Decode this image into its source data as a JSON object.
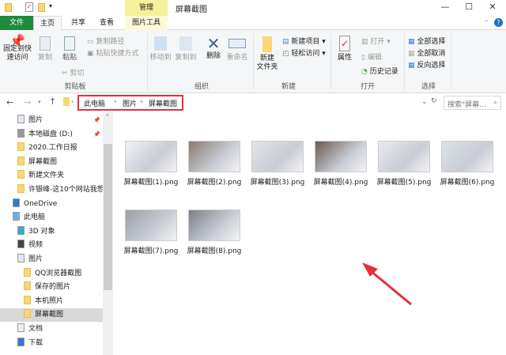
{
  "window": {
    "title": "屏幕截图",
    "contextual_tab": "管理",
    "minimize": "—",
    "maximize": "☐",
    "close": "✕"
  },
  "tabs": [
    {
      "label": "文件"
    },
    {
      "label": "主页"
    },
    {
      "label": "共享"
    },
    {
      "label": "查看"
    },
    {
      "label": "图片工具"
    }
  ],
  "ribbon": {
    "clipboard": {
      "pin": "固定到快\n速访问",
      "copy": "复制",
      "paste": "粘贴",
      "copy_path": "复制路径",
      "paste_shortcut": "粘贴快捷方式",
      "cut": "剪切",
      "label": "剪贴板"
    },
    "organize": {
      "move_to": "移动到",
      "copy_to": "复制到",
      "delete": "删除",
      "rename": "重命名",
      "label": "组织"
    },
    "new": {
      "new_folder": "新建\n文件夹",
      "new_item": "新建项目 ▾",
      "easy_access": "轻松访问 ▾",
      "label": "新建"
    },
    "open": {
      "properties": "属性",
      "open": "打开 ▾",
      "edit": "编辑",
      "history": "历史记录",
      "label": "打开"
    },
    "select": {
      "select_all": "全部选择",
      "select_none": "全部取消",
      "invert": "反向选择",
      "label": "选择"
    }
  },
  "address": {
    "crumbs": [
      "此电脑",
      "图片",
      "屏幕截图"
    ],
    "search_placeholder": "搜索\"屏幕..."
  },
  "nav": [
    {
      "label": "图片",
      "type": "pic",
      "pinned": true
    },
    {
      "label": "本地磁盘 (D:)",
      "type": "drive",
      "pinned": true
    },
    {
      "label": "2020.工作日报",
      "type": "folder"
    },
    {
      "label": "屏幕截图",
      "type": "folder"
    },
    {
      "label": "新建文件夹",
      "type": "folder"
    },
    {
      "label": "许银峰-这10个网站我想",
      "type": "folder"
    },
    {
      "label": "OneDrive",
      "type": "cloud"
    },
    {
      "label": "此电脑",
      "type": "pc"
    },
    {
      "label": "3D 对象",
      "type": "3d"
    },
    {
      "label": "视频",
      "type": "video"
    },
    {
      "label": "图片",
      "type": "pic"
    },
    {
      "label": "QQ浏览器截图",
      "type": "folder"
    },
    {
      "label": "保存的图片",
      "type": "folder"
    },
    {
      "label": "本机照片",
      "type": "folder"
    },
    {
      "label": "屏幕截图",
      "type": "folder",
      "selected": true
    },
    {
      "label": "文档",
      "type": "doc"
    },
    {
      "label": "下载",
      "type": "download"
    }
  ],
  "files": [
    "屏幕截图(1).png",
    "屏幕截图(2).png",
    "屏幕截图(3).png",
    "屏幕截图(4).png",
    "屏幕截图(5).png",
    "屏幕截图(6).png",
    "屏幕截图(7).png",
    "屏幕截图(8).png"
  ],
  "colors": {
    "file_tab": "#1e8a3c",
    "manage_tab": "#f4f19a",
    "highlight_box": "#e5303a",
    "arrow": "#e5303a",
    "selected_nav": "#d9d9d9"
  }
}
